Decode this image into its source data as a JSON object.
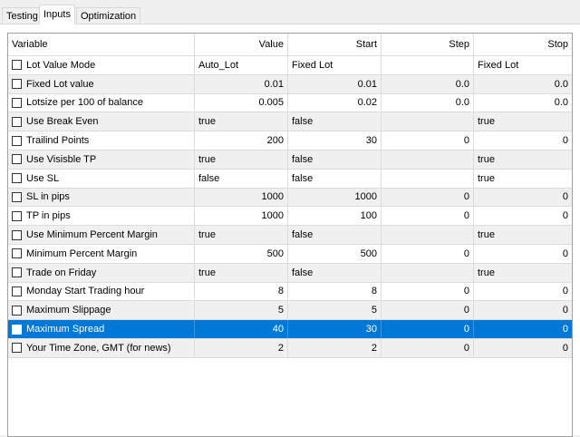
{
  "tabs": [
    {
      "label": "Testing"
    },
    {
      "label": "Inputs"
    },
    {
      "label": "Optimization"
    }
  ],
  "active_tab": "Inputs",
  "table": {
    "columns": [
      "Variable",
      "Value",
      "Start",
      "Step",
      "Stop"
    ],
    "rows": [
      {
        "variable": "Lot Value Mode",
        "value": "Auto_Lot",
        "start": "Fixed Lot",
        "step": "",
        "stop": "Fixed Lot",
        "numeric": false
      },
      {
        "variable": "Fixed Lot value",
        "value": "0.01",
        "start": "0.01",
        "step": "0.0",
        "stop": "0.0",
        "numeric": true
      },
      {
        "variable": "Lotsize per 100 of balance",
        "value": "0.005",
        "start": "0.02",
        "step": "0.0",
        "stop": "0.0",
        "numeric": true
      },
      {
        "variable": "Use Break Even",
        "value": "true",
        "start": "false",
        "step": "",
        "stop": "true",
        "numeric": false
      },
      {
        "variable": "Trailind Points",
        "value": "200",
        "start": "30",
        "step": "0",
        "stop": "0",
        "numeric": true
      },
      {
        "variable": "Use Visisble TP",
        "value": "true",
        "start": "false",
        "step": "",
        "stop": "true",
        "numeric": false
      },
      {
        "variable": "Use SL",
        "value": "false",
        "start": "false",
        "step": "",
        "stop": "true",
        "numeric": false
      },
      {
        "variable": "SL in pips",
        "value": "1000",
        "start": "1000",
        "step": "0",
        "stop": "0",
        "numeric": true
      },
      {
        "variable": "TP in pips",
        "value": "1000",
        "start": "100",
        "step": "0",
        "stop": "0",
        "numeric": true
      },
      {
        "variable": "Use Minimum Percent Margin",
        "value": "true",
        "start": "false",
        "step": "",
        "stop": "true",
        "numeric": false
      },
      {
        "variable": "Minimum Percent Margin",
        "value": "500",
        "start": "500",
        "step": "0",
        "stop": "0",
        "numeric": true
      },
      {
        "variable": "Trade on Friday",
        "value": "true",
        "start": "false",
        "step": "",
        "stop": "true",
        "numeric": false
      },
      {
        "variable": "Monday Start Trading hour",
        "value": "8",
        "start": "8",
        "step": "0",
        "stop": "0",
        "numeric": true
      },
      {
        "variable": "Maximum Slippage",
        "value": "5",
        "start": "5",
        "step": "0",
        "stop": "0",
        "numeric": true
      },
      {
        "variable": "Maximum Spread",
        "value": "40",
        "start": "30",
        "step": "0",
        "stop": "0",
        "numeric": true,
        "selected": true
      },
      {
        "variable": "Your Time Zone, GMT (for news)",
        "value": "2",
        "start": "2",
        "step": "0",
        "stop": "0",
        "numeric": true
      }
    ]
  },
  "colors": {
    "selection": "#0078d7",
    "alt_row": "#f0f0f0",
    "grid_line": "#dcdcdc"
  }
}
